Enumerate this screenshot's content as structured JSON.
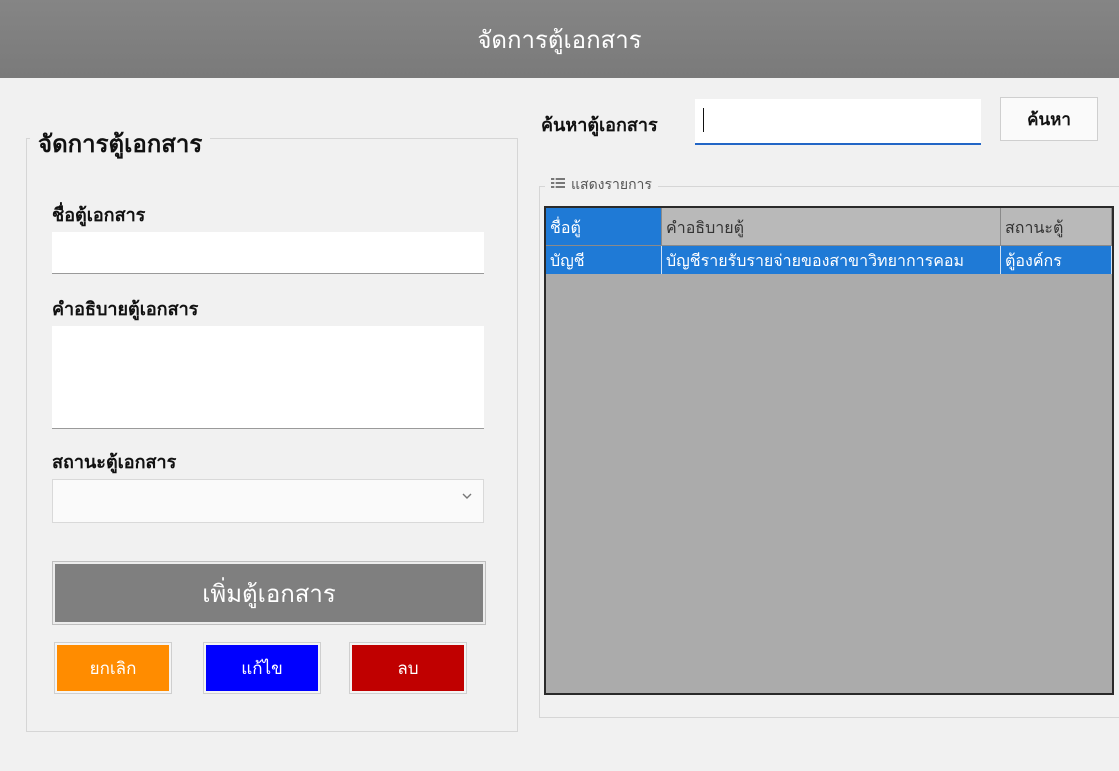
{
  "window": {
    "title": "จัดการตู้เอกสาร"
  },
  "form": {
    "group_title": "จัดการตู้เอกสาร",
    "name_label": "ชื่อตู้เอกสาร",
    "name_value": "",
    "desc_label": "คำอธิบายตู้เอกสาร",
    "desc_value": "",
    "status_label": "สถานะตู้เอกสาร",
    "status_value": "",
    "add_button": "เพิ่มตู้เอกสาร",
    "cancel_button": "ยกเลิก",
    "edit_button": "แก้ไข",
    "delete_button": "ลบ"
  },
  "search": {
    "label": "ค้นหาตู้เอกสาร",
    "value": "",
    "button": "ค้นหา"
  },
  "list": {
    "group_title": "แสดงรายการ",
    "columns": [
      "ชื่อตู้",
      "คำอธิบายตู้",
      "สถานะตู้"
    ],
    "rows": [
      [
        "บัญชี",
        "บัญชีรายรับรายจ่ายของสาขาวิทยาการคอม",
        "ตู้องค์กร"
      ]
    ]
  },
  "colors": {
    "titlebar": "#808080",
    "add_button": "#7f7f7f",
    "cancel_button": "#ff8c00",
    "edit_button": "#0000ff",
    "delete_button": "#c00000",
    "selection": "#1f7ad6",
    "grid_background": "#ababab"
  }
}
